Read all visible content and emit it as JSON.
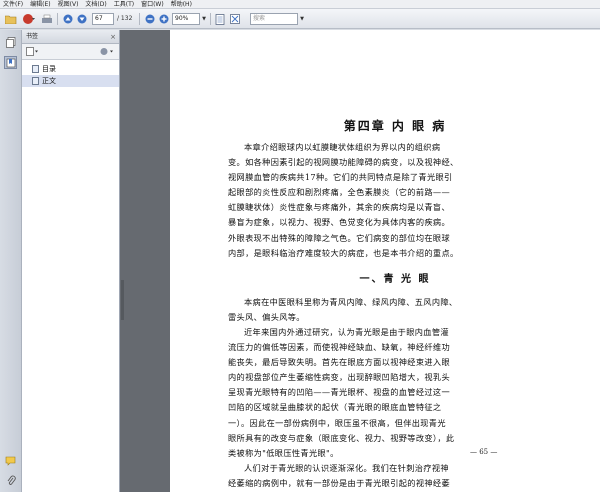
{
  "menu": [
    "文件(F)",
    "编辑(E)",
    "视图(V)",
    "文档(D)",
    "工具(T)",
    "窗口(W)",
    "帮助(H)"
  ],
  "toolbar": {
    "current_page": "67",
    "total_pages": "/ 132",
    "zoom": "90%",
    "search_placeholder": "搜索"
  },
  "panel": {
    "title": "书签",
    "close": "×",
    "bookmarks": [
      "目录",
      "正文"
    ]
  },
  "document": {
    "chapter_title": "第四章  内 眼 病",
    "intro": [
      "本章介绍眼球内以虹膜睫状体组织为界以内的组织病",
      "变。如各种因素引起的视网膜功能障碍的病变，以及视神经、",
      "视网膜血管的疾病共17种。它们的共同特点是除了青光眼引",
      "起眼部的炎性反应和剧烈疼痛，全色素膜炎（它的前路——",
      "虹膜睫状体）炎性症象与疼痛外，其余的疾病均是以青盲、",
      "暴盲为症象，以视力、视野、色觉变化为具体内客的疾病。",
      "外眼表现不出特殊的障障之气色。它们病变的部位均在眼球",
      "内部，是眼科临治疗难度较大的病症，也是本书介绍的重点。"
    ],
    "section_title": "一、青 光 眼",
    "body": [
      "本病在中医眼科里称为青风内障、绿风内障、五风内障、",
      "雷头风、偏头风等。",
      "近年来国内外通过研究，认为青光眼是由于眼内血管灌",
      "流压力的偏低等因素，而使视神经缺血、缺氧，神经纤维功",
      "能丧失，最后导致失明。首先在眼底方面以视神经束进入眼",
      "内的视盘部位产生萎缩性病变，出现醉眼凹陷增大，视乳头",
      "呈现青光眼特有的凹陷——青光眼杯、视盘的血管经过这一",
      "凹陷的区域就呈曲膝状的起伏（青光眼的眼底血管特征之",
      "一）。因此在一部份病例中，眼压虽不很高，但伴出现青光",
      "眼所具有的改变与症象（眼底变化、视力、视野等改变），此",
      "类被称为\"低眼压性青光眼\"。",
      "人们对于青光眼的认识逐渐深化。我们在针刺治疗视神",
      "经萎缩的病例中，就有一部份是由于青光眼引起的视神经萎"
    ],
    "page_number": "— 65 —"
  }
}
